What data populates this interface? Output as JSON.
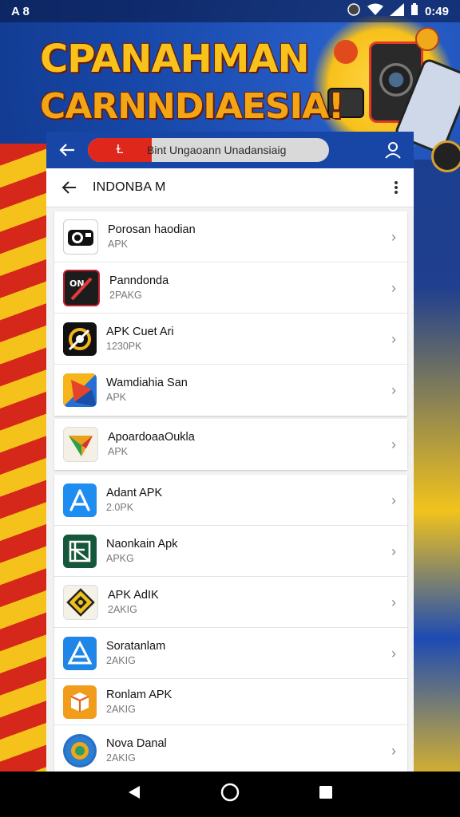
{
  "status_bar": {
    "left_text": "A 8",
    "time": "0:49",
    "icons": [
      "notification-icon",
      "wifi-icon",
      "signal-icon",
      "battery-icon"
    ]
  },
  "banner": {
    "line1": "CPANAHMAN",
    "line2": "CARNNDIAESIA!"
  },
  "header": {
    "search_badge": "Ɫ",
    "search_text": "Bint Ungaoann Unadansiaig"
  },
  "toolbar": {
    "title": "INDONBA M"
  },
  "apps": [
    {
      "name": "Porosan haodian",
      "sub": "APK",
      "icon": "camera-app-icon"
    },
    {
      "name": "Panndonda",
      "sub": "2PAKG",
      "icon": "slash-app-icon"
    },
    {
      "name": "APK Cuet Ari",
      "sub": "1230PK",
      "icon": "ring-app-icon"
    },
    {
      "name": "Wamdiahia San",
      "sub": "APK",
      "icon": "triangle-app-icon"
    },
    {
      "name": "ApoardoaaOukla",
      "sub": "APK",
      "icon": "play-app-icon"
    },
    {
      "name": "Adant APK",
      "sub": "2.0PK",
      "icon": "app-store-icon"
    },
    {
      "name": "Naonkain Apk",
      "sub": "APKG",
      "icon": "frame-app-icon"
    },
    {
      "name": "APK AdIK",
      "sub": "2AKIG",
      "icon": "diamond-app-icon"
    },
    {
      "name": "Soratanlam",
      "sub": "2AKIG",
      "icon": "a-app-icon"
    },
    {
      "name": "Ronlam APK",
      "sub": "2AKIG",
      "icon": "box-app-icon"
    },
    {
      "name": "Nova Danal",
      "sub": "2AKIG",
      "icon": "globe-app-icon"
    }
  ],
  "navbar": [
    "back-icon",
    "home-icon",
    "recents-icon"
  ]
}
